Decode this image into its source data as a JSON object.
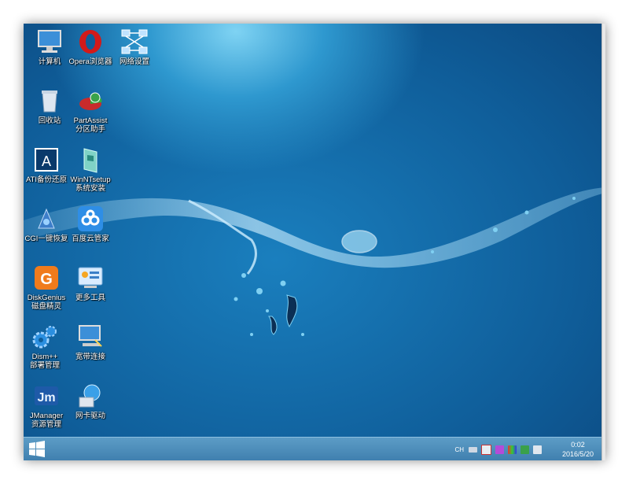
{
  "desktop_icons": [
    {
      "key": "computer",
      "label1": "计算机",
      "label2": ""
    },
    {
      "key": "opera",
      "label1": "Opera浏览器",
      "label2": ""
    },
    {
      "key": "network",
      "label1": "网络设置",
      "label2": ""
    },
    {
      "key": "recycle",
      "label1": "回收站",
      "label2": ""
    },
    {
      "key": "partassist",
      "label1": "PartAssist",
      "label2": "分区助手"
    },
    {
      "key": "ati",
      "label1": "ATI备份还原",
      "label2": ""
    },
    {
      "key": "winnt",
      "label1": "WinNTsetup",
      "label2": "系统安装"
    },
    {
      "key": "cgi",
      "label1": "CGI一键恢复",
      "label2": ""
    },
    {
      "key": "baidu",
      "label1": "百度云管家",
      "label2": ""
    },
    {
      "key": "diskgenius",
      "label1": "DiskGenius",
      "label2": "磁盘精灵"
    },
    {
      "key": "moretools",
      "label1": "更多工具",
      "label2": ""
    },
    {
      "key": "dism",
      "label1": "Dism++",
      "label2": "部署管理"
    },
    {
      "key": "broadband",
      "label1": "宽带连接",
      "label2": ""
    },
    {
      "key": "jmanager",
      "label1": "JManager",
      "label2": "资源管理"
    },
    {
      "key": "nicdriver",
      "label1": "网卡驱动",
      "label2": ""
    }
  ],
  "taskbar": {
    "input_indicator": "CH",
    "clock_time": "0:02",
    "clock_date": "2016/5/20"
  },
  "colors": {
    "taskbar": "#4a8bb8",
    "desktop": "#0f5d99",
    "accent": "#7fd3f3"
  }
}
